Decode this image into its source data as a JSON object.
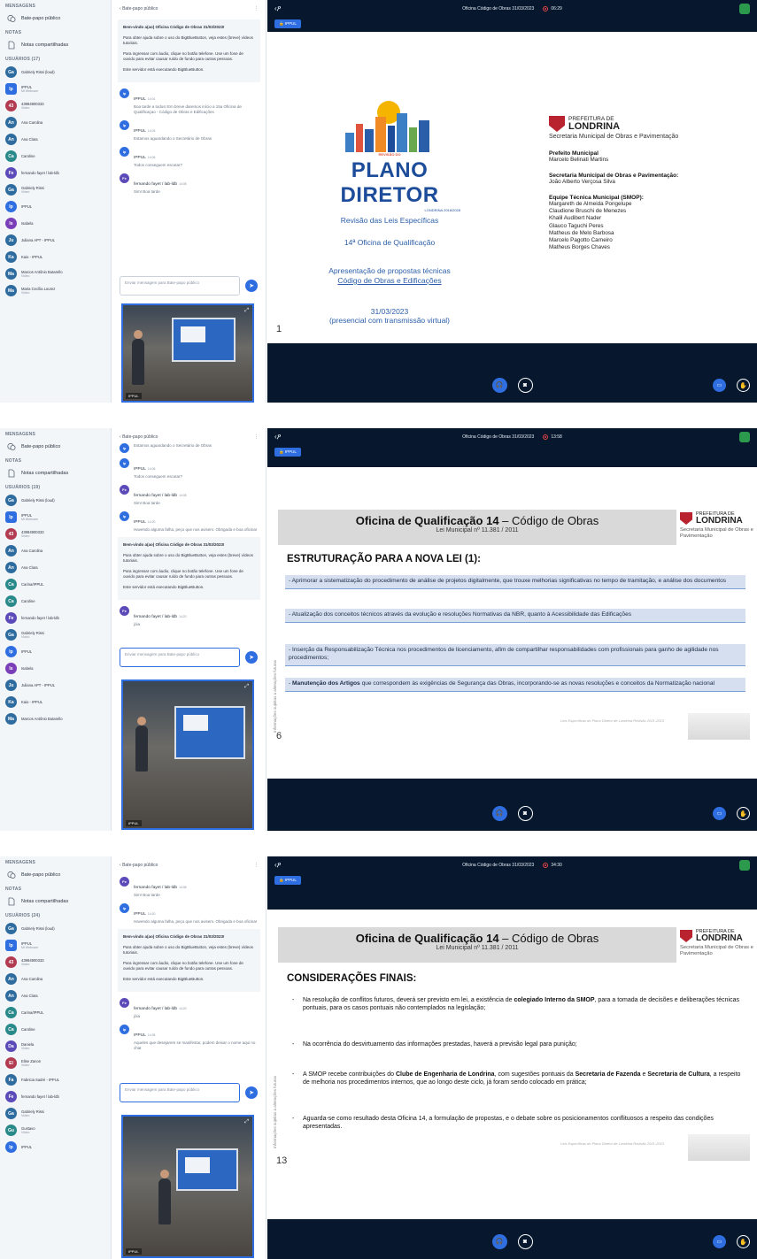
{
  "common": {
    "sidebar": {
      "section_messages": "MENSAGENS",
      "public_chat": "Bate-papo público",
      "section_notes": "NOTAS",
      "shared_notes": "Notas compartilhadas"
    },
    "chat_header": "Bate-papo público",
    "chat_placeholder": "Enviar mensagem para Bate-papo público",
    "welcome": {
      "line1_prefix": "Bem-vindo a(ao)",
      "line1_title": "Oficina Código de Obras 31/03/2023!",
      "line2": "Para obter ajuda sobre o uso do BigBlueButton, veja estes (breve) vídeos tutoriais.",
      "line3": "Para ingressar com áudio, clique no botão telefone. Use um fone de ouvido para evitar causar ruído de fundo para outras pessoas.",
      "line4": "Este servidor está executando BigBlueButton."
    },
    "meeting_title": "Oficina Código de Obras 31/03/2023",
    "presenter_badge": "IPPUL",
    "cam_label": "IPPUL",
    "slide_banner_title_bold": "Oficina de Qualificação 14",
    "slide_banner_title_rest": " – Código de Obras",
    "slide_banner_sub": "Lei Municipal nº 11.381 / 2011",
    "pref_a": "PREFEITURA DE",
    "pref_b": "LONDRINA",
    "pref_sec": "Secretaria Municipal de Obras e Pavimentação",
    "vertical_note": "Informações sujeitas a alterações futuras",
    "footer_note": "Leis Específicas do Plano Diretor de Londrina Revisão 2021-2023"
  },
  "shots": [
    {
      "timer": "06:29",
      "users_title": "USUÁRIOS (17)",
      "users": [
        {
          "ini": "Ga",
          "name": "Gabriely Rissi (loud)",
          "sub": "",
          "color": "#2e6b9e"
        },
        {
          "ini": "Ip",
          "name": "IPPUL",
          "sub": "Mi Webcam",
          "color": "#2f6ee0"
        },
        {
          "ini": "43",
          "name": "43984900333",
          "sub": "Vídeo",
          "color": "#b23b52"
        },
        {
          "ini": "An",
          "name": "Ana Carolina",
          "sub": "",
          "color": "#2e6b9e"
        },
        {
          "ini": "An",
          "name": "Ana Clara",
          "sub": "",
          "color": "#2e6b9e"
        },
        {
          "ini": "Ca",
          "name": "Caroline",
          "sub": "",
          "color": "#2a8a8a"
        },
        {
          "ini": "Fe",
          "name": "fernando fayet / lab-ldb",
          "sub": "",
          "color": "#5b4ab8"
        },
        {
          "ini": "Ga",
          "name": "Gabriely Rissi",
          "sub": "Vídeo",
          "color": "#2e6b9e"
        },
        {
          "ini": "Ip",
          "name": "IPPUL",
          "sub": "",
          "color": "#2f6ee0"
        },
        {
          "ini": "Is",
          "name": "Isabela",
          "sub": "",
          "color": "#7a3fb8"
        },
        {
          "ini": "Ju",
          "name": "Juliana APT - IPPUL",
          "sub": "",
          "color": "#2e6b9e"
        },
        {
          "ini": "Ka",
          "name": "Kaio - IPPUL",
          "sub": "",
          "color": "#2e6b9e"
        },
        {
          "ini": "Ma",
          "name": "Marcos Antônio Butarello",
          "sub": "Vídeo",
          "color": "#2e6b9e"
        },
        {
          "ini": "Ma",
          "name": "Maria Cecília Lourez",
          "sub": "Vídeo",
          "color": "#2e6b9e"
        }
      ],
      "messages": [
        {
          "ini": "Ip",
          "name": "IPPUL",
          "time": "14:01",
          "text": "Boa tarde a todos! Em breve daremos início a 15a Oficina de Qualificaçao - Código de Obras e Edificações",
          "color": "#2f6ee0"
        },
        {
          "ini": "Ip",
          "name": "IPPUL",
          "time": "14:03",
          "text": "Estamos aguardando o Secretário de Obras",
          "color": "#2f6ee0"
        },
        {
          "ini": "Ip",
          "name": "IPPUL",
          "time": "14:06",
          "text": "Todos conseguem escutar?",
          "color": "#2f6ee0"
        },
        {
          "ini": "Fe",
          "name": "fernando fayet / lab-ldb",
          "time": "14:08",
          "text": "Sim! Boa tarde",
          "color": "#5b4ab8"
        }
      ],
      "slide": {
        "number": "1",
        "pd_small_top": "REVISÃO DO",
        "pd_title": "PLANO DIRETOR",
        "pd_small_bottom": "LONDRINA 2018/2028",
        "pd_line1": "Revisão das Leis Específicas",
        "pd_line2": "14ª Oficina de Qualificação",
        "pd_line3": "Apresentação de propostas técnicas",
        "pd_line4": "Código de Obras e Edificações",
        "pd_date": "31/03/2023",
        "pd_mode": "(presencial com transmissão virtual)",
        "pref_sec": "Secretaria Municipal de Obras e Pavimentação",
        "h1": "Prefeito Municipal",
        "t1": "Marcelo Belinati Martins",
        "h2": "Secretaria Municipal de Obras e Pavimentação:",
        "t2": "João Alberto Verçosa Silva",
        "h3": "Equipe Técnica Municipal (SMOP):",
        "team": [
          "Margareth de Almeida Pongelupe",
          "Claudione Bruschi de Menezes",
          "Khalil Audibert Nader",
          "Glauco Taguchi Peres",
          "Matheus de Melo Barbosa",
          "Marcelo Pagotto Carneiro",
          "Matheus Borges Chaves"
        ]
      }
    },
    {
      "timer": "13:58",
      "users_title": "USUÁRIOS (19)",
      "users": [
        {
          "ini": "Ga",
          "name": "Gabriely Rissi (loud)",
          "sub": "",
          "color": "#2e6b9e"
        },
        {
          "ini": "Ip",
          "name": "IPPUL",
          "sub": "Mi Webcam",
          "color": "#2f6ee0"
        },
        {
          "ini": "43",
          "name": "43984900333",
          "sub": "Vídeo",
          "color": "#b23b52"
        },
        {
          "ini": "An",
          "name": "Ana Carolina",
          "sub": "",
          "color": "#2e6b9e"
        },
        {
          "ini": "An",
          "name": "Ana Clara",
          "sub": "",
          "color": "#2e6b9e"
        },
        {
          "ini": "Ca",
          "name": "Carina/IPPUL",
          "sub": "",
          "color": "#2a8a8a"
        },
        {
          "ini": "Ca",
          "name": "Caroline",
          "sub": "",
          "color": "#2a8a8a"
        },
        {
          "ini": "Fe",
          "name": "fernando fayet / lab-ldb",
          "sub": "",
          "color": "#5b4ab8"
        },
        {
          "ini": "Ga",
          "name": "Gabriely Rissi",
          "sub": "Vídeo",
          "color": "#2e6b9e"
        },
        {
          "ini": "Ip",
          "name": "IPPUL",
          "sub": "",
          "color": "#2f6ee0"
        },
        {
          "ini": "Is",
          "name": "Isabela",
          "sub": "",
          "color": "#7a3fb8"
        },
        {
          "ini": "Ju",
          "name": "Juliana APT - IPPUL",
          "sub": "",
          "color": "#2e6b9e"
        },
        {
          "ini": "Ka",
          "name": "Kaio - IPPUL",
          "sub": "",
          "color": "#2e6b9e"
        },
        {
          "ini": "Ma",
          "name": "Marcos Antônio Butarello",
          "sub": "",
          "color": "#2e6b9e"
        }
      ],
      "messages_top": [
        {
          "ini": "Ip",
          "name": "",
          "time": "",
          "text": "Estamos aguardando o Secretário de Obras",
          "color": "#2f6ee0"
        },
        {
          "ini": "Ip",
          "name": "IPPUL",
          "time": "14:06",
          "text": "Todos conseguem escutar?",
          "color": "#2f6ee0"
        },
        {
          "ini": "Fe",
          "name": "fernando fayet / lab-ldb",
          "time": "14:08",
          "text": "Sim! Boa tarde",
          "color": "#5b4ab8"
        },
        {
          "ini": "Ip",
          "name": "IPPUL",
          "time": "14:20",
          "text": "Havendo alguma falha, peço que nos avisem. Obrigada e boa oficina!",
          "color": "#2f6ee0"
        }
      ],
      "messages_bottom": [
        {
          "ini": "Fe",
          "name": "fernando fayet / lab-ldb",
          "time": "14:20",
          "text": "jóia",
          "color": "#5b4ab8"
        }
      ],
      "slide": {
        "number": "6",
        "heading": "ESTRUTURAÇÃO PARA A NOVA LEI (1):",
        "items": [
          {
            "pre": "",
            "bold": "",
            "text": "- Aprimorar a sistematização do procedimento de análise de projetos digitalmente, que trouxe melhorias significativas no tempo de tramitação, e análise dos documentos"
          },
          {
            "pre": "",
            "bold": "",
            "text": "- Atualização dos conceitos técnicos através da evolução e resoluções Normativas da NBR, quanto à Acessibilidade das Edificações"
          },
          {
            "pre": "",
            "bold": "",
            "text": "- Inserção da Responsabilização Técnica nos procedimentos de licenciamento, afim de compartilhar responsabilidades com profissionais para ganho de agilidade nos procedimentos;"
          },
          {
            "pre": "- ",
            "bold": "Manutenção dos Artigos",
            "text": " que correspondem às exigências de Segurança das Obras, incorporando-se as novas resoluções e conceitos da Normatização nacional"
          }
        ]
      }
    },
    {
      "timer": "34:30",
      "users_title": "USUÁRIOS (24)",
      "users": [
        {
          "ini": "Ga",
          "name": "Gabriely Rissi (loud)",
          "sub": "",
          "color": "#2e6b9e"
        },
        {
          "ini": "Ip",
          "name": "IPPUL",
          "sub": "Mi Webcam",
          "color": "#2f6ee0"
        },
        {
          "ini": "43",
          "name": "43984900333",
          "sub": "Vídeo",
          "color": "#b23b52"
        },
        {
          "ini": "An",
          "name": "Ana Carolina",
          "sub": "",
          "color": "#2e6b9e"
        },
        {
          "ini": "An",
          "name": "Ana Clara",
          "sub": "",
          "color": "#2e6b9e"
        },
        {
          "ini": "Ca",
          "name": "Carina/IPPUL",
          "sub": "",
          "color": "#2a8a8a"
        },
        {
          "ini": "Ca",
          "name": "Caroline",
          "sub": "",
          "color": "#2a8a8a"
        },
        {
          "ini": "Da",
          "name": "Daniela",
          "sub": "Vídeo",
          "color": "#5b4ab8"
        },
        {
          "ini": "El",
          "name": "Elise Zanon",
          "sub": "Vídeo",
          "color": "#b23b52"
        },
        {
          "ini": "Fa",
          "name": "Fabricia Sadré - IPPUL",
          "sub": "",
          "color": "#2e6b9e"
        },
        {
          "ini": "Fe",
          "name": "fernando fayet / lab-ldb",
          "sub": "",
          "color": "#5b4ab8"
        },
        {
          "ini": "Ga",
          "name": "Gabriely Rissi",
          "sub": "Vídeo",
          "color": "#2e6b9e"
        },
        {
          "ini": "Gu",
          "name": "Gustavo",
          "sub": "Vídeo",
          "color": "#2a8a8a"
        },
        {
          "ini": "Ip",
          "name": "IPPUL",
          "sub": "",
          "color": "#2f6ee0"
        }
      ],
      "messages_top": [
        {
          "ini": "Fe",
          "name": "fernando fayet / lab-ldb",
          "time": "14:08",
          "text": "Sim! Boa tarde",
          "color": "#5b4ab8"
        },
        {
          "ini": "Ip",
          "name": "IPPUL",
          "time": "14:20",
          "text": "Havendo alguma falha, peço que nos avisem. Obrigada e boa oficina!",
          "color": "#2f6ee0"
        }
      ],
      "messages_bottom": [
        {
          "ini": "Fe",
          "name": "fernando fayet / lab-ldb",
          "time": "14:20",
          "text": "jóia",
          "color": "#5b4ab8"
        },
        {
          "ini": "Ip",
          "name": "IPPUL",
          "time": "14:35",
          "text": "Aqueles que desejarem se manifestar, podem deixar o nome aqui no chat",
          "color": "#2f6ee0"
        }
      ],
      "slide": {
        "number": "13",
        "heading": "CONSIDERAÇÕES FINAIS:",
        "b1_pre": "Na resolução de conflitos futuros, deverá ser previsto em lei, a existência de ",
        "b1_bold": "colegiado Interno da SMOP",
        "b1_post": ", para a tomada de decisões e deliberações técnicas pontuais, para os casos pontuais não contemplados na legislação;",
        "b2": "Na ocorrência do desvirtuamento das informações prestadas, haverá a previsão legal para punição;",
        "b3_pre": "A SMOP recebe contribuições do ",
        "b3_bold1": "Clube de Engenharia de Londrina",
        "b3_mid1": ", com sugestões pontuais da ",
        "b3_bold2": "Secretaria de Fazenda",
        "b3_mid2": " e ",
        "b3_bold3": "Secretaria de Cultura",
        "b3_post": ", a respeito de melhoria nos procedimentos internos, que ao longo deste ciclo, já foram sendo colocado em prática;",
        "b4": "Aguarda-se como resultado desta Oficina 14, a formulação de propostas, e o debate sobre os posicionamentos conflituosos a respeito das condições apresentadas."
      }
    }
  ]
}
